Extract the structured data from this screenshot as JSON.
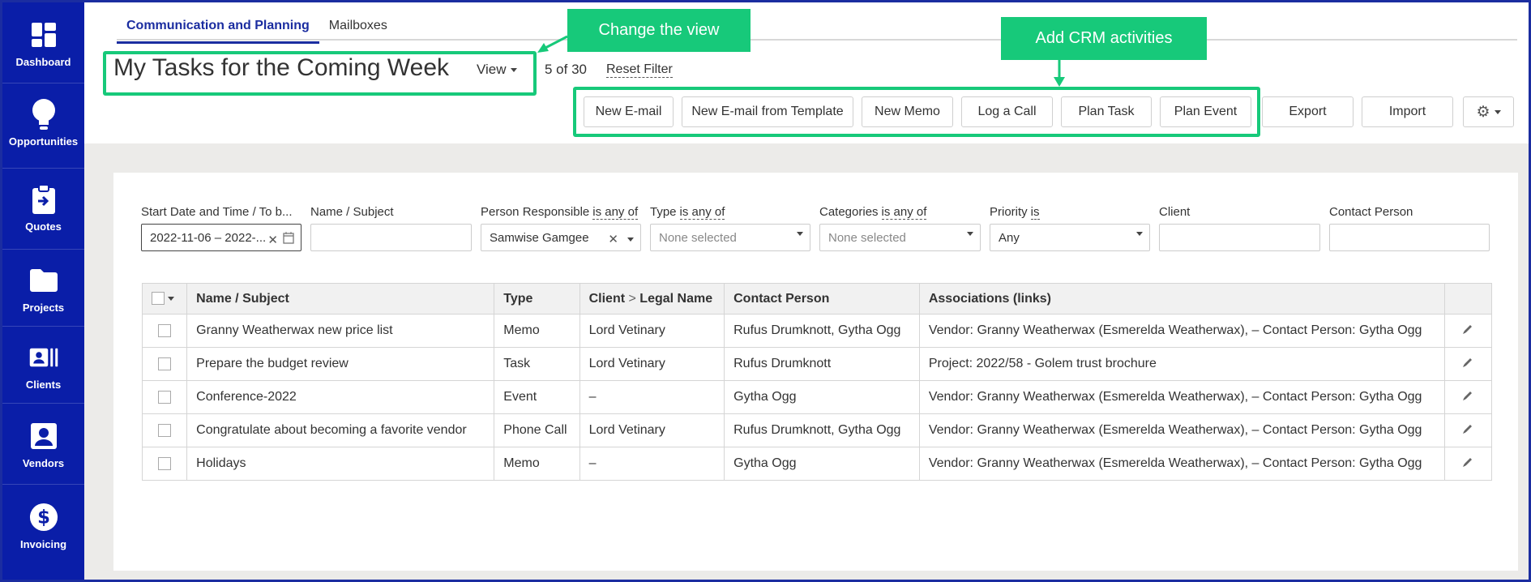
{
  "sidebar": {
    "items": [
      {
        "label": "Dashboard",
        "icon": "dashboard-icon"
      },
      {
        "label": "Opportunities",
        "icon": "lightbulb-icon"
      },
      {
        "label": "Quotes",
        "icon": "clipboard-icon"
      },
      {
        "label": "Projects",
        "icon": "folder-icon"
      },
      {
        "label": "Clients",
        "icon": "contact-card-icon"
      },
      {
        "label": "Vendors",
        "icon": "person-card-icon"
      },
      {
        "label": "Invoicing",
        "icon": "dollar-icon"
      }
    ]
  },
  "tabs": [
    "Communication and Planning",
    "Mailboxes"
  ],
  "header": {
    "title": "My Tasks for the Coming Week",
    "view_label": "View",
    "count": "5 of 30",
    "reset_filter": "Reset Filter"
  },
  "actions": {
    "new_email": "New E-mail",
    "new_email_template": "New E-mail from Template",
    "new_memo": "New Memo",
    "log_call": "Log a Call",
    "plan_task": "Plan Task",
    "plan_event": "Plan Event",
    "export": "Export",
    "import": "Import"
  },
  "callouts": {
    "change_view": "Change the view",
    "add_crm": "Add CRM activities"
  },
  "filters": {
    "start_date": {
      "label": "Start Date and Time / To b...",
      "value": "2022-11-06 – 2022-..."
    },
    "name_subject": {
      "label": "Name / Subject",
      "value": ""
    },
    "person_responsible": {
      "label": "Person Responsible",
      "op": "is any of",
      "value": "Samwise Gamgee"
    },
    "type": {
      "label": "Type",
      "op": "is any of",
      "placeholder": "None selected"
    },
    "categories": {
      "label": "Categories",
      "op": "is any of",
      "placeholder": "None selected"
    },
    "priority": {
      "label": "Priority",
      "op": "is",
      "value": "Any"
    },
    "client": {
      "label": "Client",
      "value": ""
    },
    "contact_person": {
      "label": "Contact Person",
      "value": ""
    }
  },
  "table": {
    "headers": {
      "name": "Name / Subject",
      "type": "Type",
      "client_a": "Client",
      "client_sep": ">",
      "client_b": "Legal Name",
      "contact": "Contact Person",
      "assoc": "Associations (links)"
    },
    "rows": [
      {
        "name": "Granny Weatherwax new price list",
        "type": "Memo",
        "client": "Lord Vetinary",
        "contact": "Rufus Drumknott, Gytha Ogg",
        "assoc": "Vendor: Granny Weatherwax (Esmerelda Weatherwax), – Contact Person: Gytha Ogg"
      },
      {
        "name": "Prepare the budget review",
        "type": "Task",
        "client": "Lord Vetinary",
        "contact": "Rufus Drumknott",
        "assoc": "Project: 2022/58 - Golem trust brochure"
      },
      {
        "name": "Conference-2022",
        "type": "Event",
        "client": "–",
        "contact": "Gytha Ogg",
        "assoc": "Vendor: Granny Weatherwax (Esmerelda Weatherwax), – Contact Person: Gytha Ogg"
      },
      {
        "name": "Congratulate about becoming a favorite vendor",
        "type": "Phone Call",
        "client": "Lord Vetinary",
        "contact": "Rufus Drumknott, Gytha Ogg",
        "assoc": "Vendor: Granny Weatherwax (Esmerelda Weatherwax), – Contact Person: Gytha Ogg"
      },
      {
        "name": "Holidays",
        "type": "Memo",
        "client": "–",
        "contact": "Gytha Ogg",
        "assoc": "Vendor: Granny Weatherwax (Esmerelda Weatherwax), – Contact Person: Gytha Ogg"
      }
    ]
  },
  "colors": {
    "sidebar": "#0a1ea8",
    "accent": "#1b2da0",
    "highlight": "#17c97a"
  }
}
